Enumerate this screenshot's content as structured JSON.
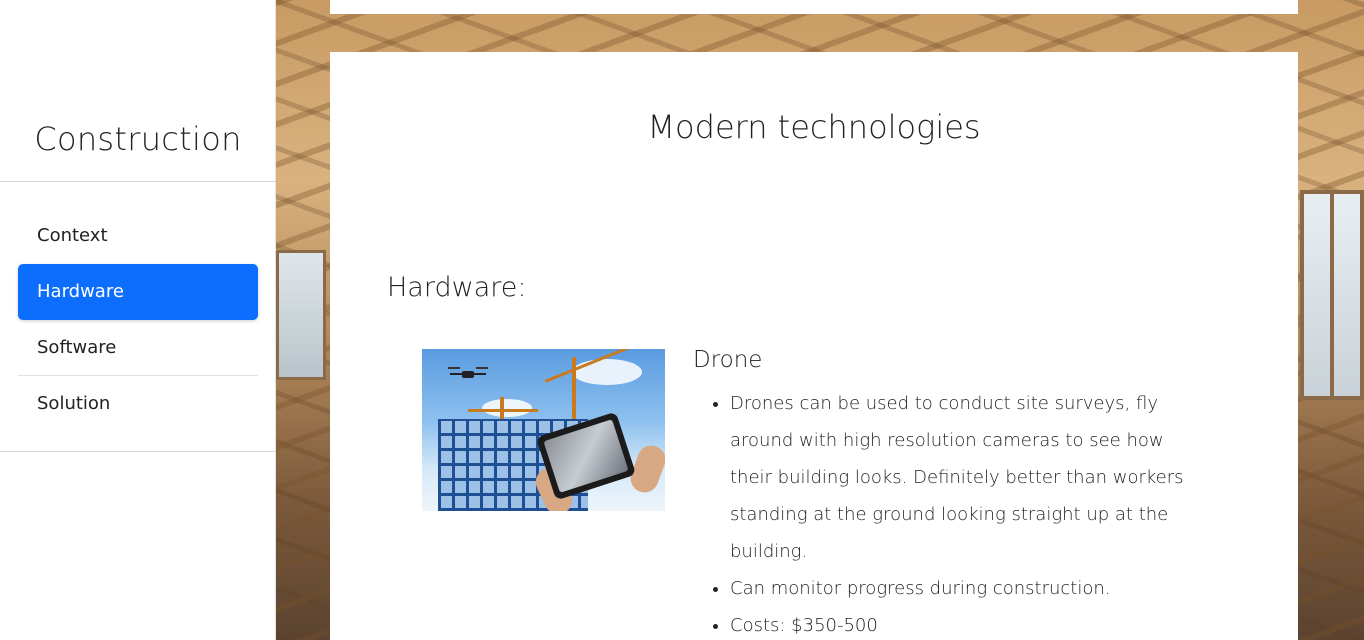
{
  "sidebar": {
    "brand": "Construction",
    "items": [
      {
        "label": "Context",
        "active": false
      },
      {
        "label": "Hardware",
        "active": true
      },
      {
        "label": "Software",
        "active": false
      },
      {
        "label": "Solution",
        "active": false
      }
    ]
  },
  "main": {
    "title": "Modern technologies",
    "section_title": "Hardware:",
    "item": {
      "title": "Drone",
      "bullets": [
        "Drones can be used to conduct site surveys, fly around with high resolution cameras to see how their building looks. Definitely better than workers standing at the ground looking straight up at the building.",
        "Can monitor progress during construction.",
        "Costs: $350-500"
      ]
    }
  },
  "colors": {
    "active_nav_bg": "#0d6efd",
    "active_nav_text": "#ffffff"
  }
}
